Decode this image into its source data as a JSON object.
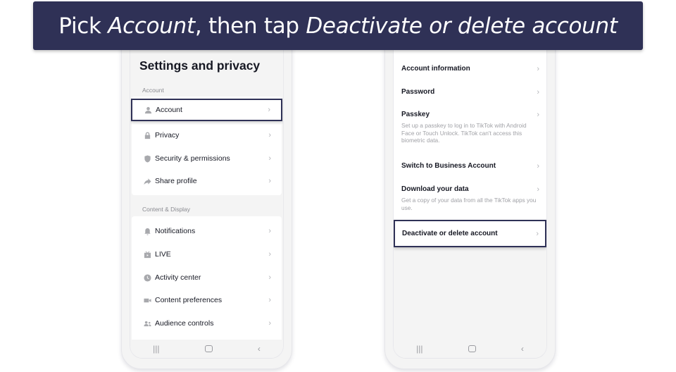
{
  "banner": {
    "text_part1": "Pick ",
    "text_em1": "Account",
    "text_part2": ", then tap ",
    "text_em2": "Deactivate or delete account"
  },
  "left_phone": {
    "title": "Settings and privacy",
    "sections": [
      {
        "label": "Account",
        "items": [
          {
            "label": "Account",
            "icon": "person-icon",
            "highlighted": true
          },
          {
            "label": "Privacy",
            "icon": "lock-icon"
          },
          {
            "label": "Security & permissions",
            "icon": "shield-icon"
          },
          {
            "label": "Share profile",
            "icon": "share-arrow-icon"
          }
        ]
      },
      {
        "label": "Content & Display",
        "items": [
          {
            "label": "Notifications",
            "icon": "bell-icon"
          },
          {
            "label": "LIVE",
            "icon": "tv-icon"
          },
          {
            "label": "Activity center",
            "icon": "clock-icon"
          },
          {
            "label": "Content preferences",
            "icon": "video-camera-icon"
          },
          {
            "label": "Audience controls",
            "icon": "people-icon"
          }
        ]
      }
    ]
  },
  "right_phone": {
    "items": [
      {
        "label": "Account information",
        "description": ""
      },
      {
        "label": "Password",
        "description": ""
      },
      {
        "label": "Passkey",
        "description": "Set up a passkey to log in to TikTok with Android Face or Touch Unlock. TikTok can't access this biometric data."
      },
      {
        "label": "Switch to Business Account",
        "description": ""
      },
      {
        "label": "Download your data",
        "description": "Get a copy of your data from all the TikTok apps you use."
      },
      {
        "label": "Deactivate or delete account",
        "description": "",
        "highlighted": true
      }
    ]
  },
  "chevron": "›",
  "navbar": {
    "recents": "|||",
    "back": "‹"
  }
}
